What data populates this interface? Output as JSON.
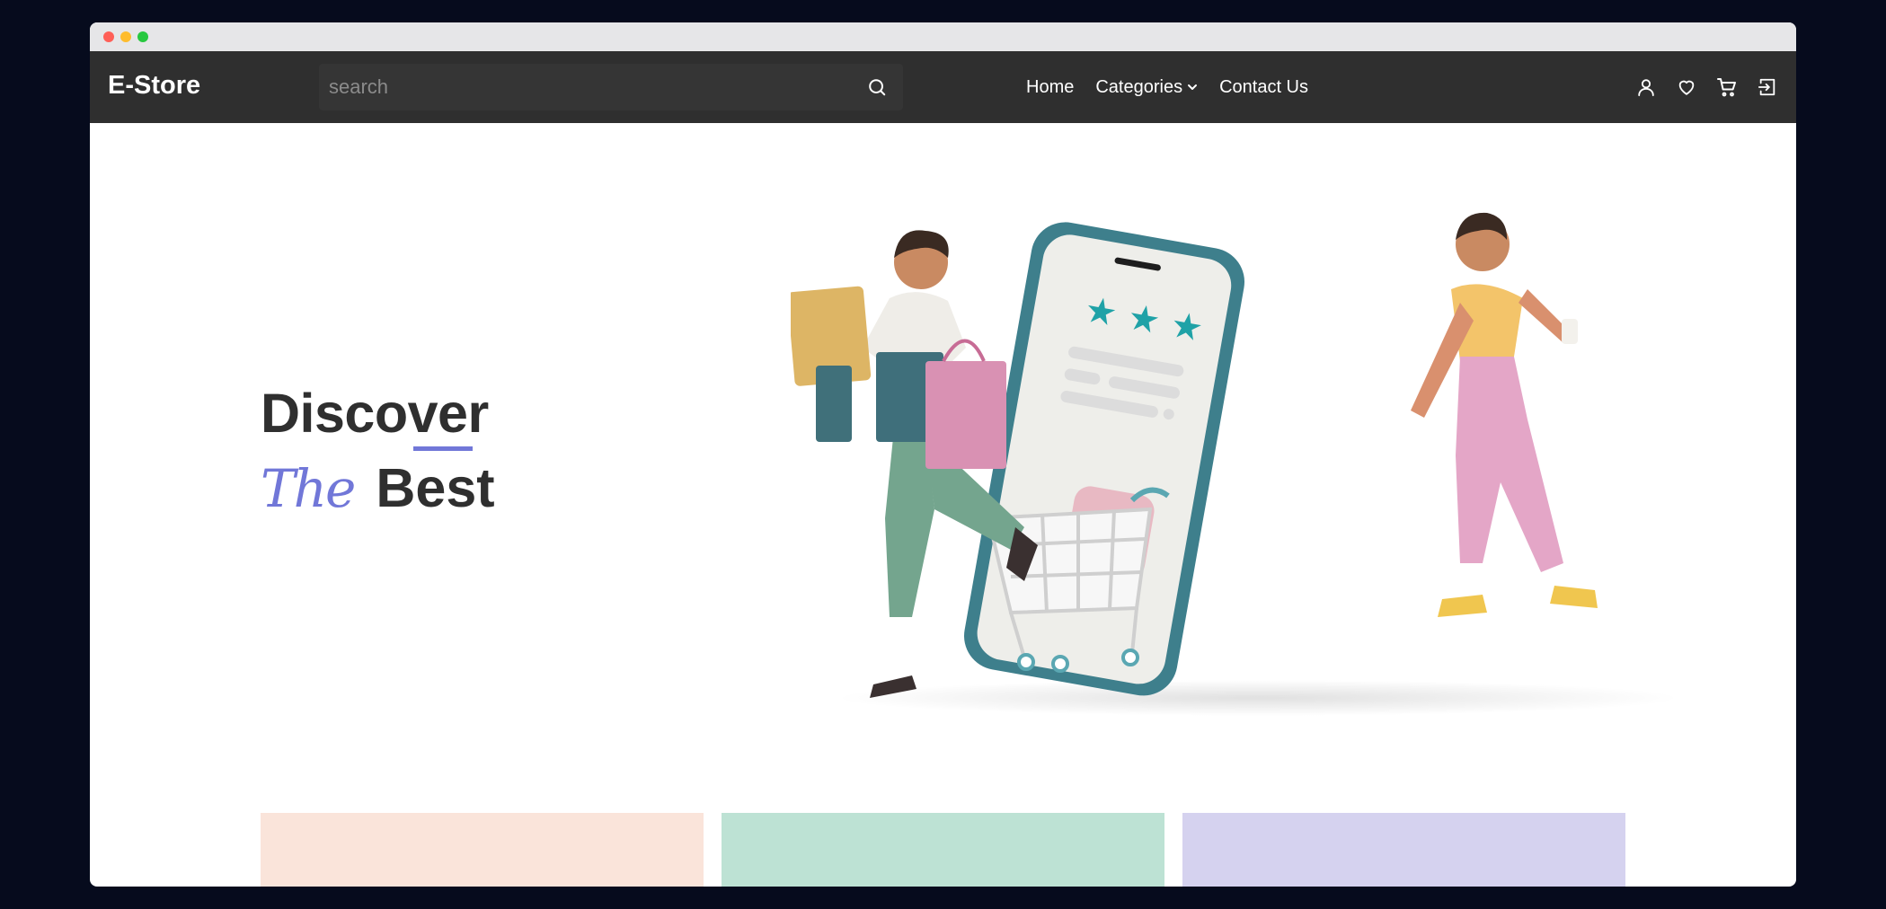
{
  "browser": {
    "traffic_lights": [
      "#ff5f57",
      "#febc2e",
      "#28c840"
    ]
  },
  "navbar": {
    "brand": "E-Store",
    "search": {
      "placeholder": "search",
      "value": "",
      "icon": "search-icon"
    },
    "links": [
      {
        "label": "Home"
      },
      {
        "label": "Categories",
        "icon": "chevron-down-icon"
      },
      {
        "label": "Contact Us"
      }
    ],
    "icons": [
      "user-icon",
      "heart-icon",
      "cart-icon",
      "login-icon"
    ]
  },
  "hero": {
    "line1": "Discover",
    "line2_script": "The",
    "line2": "Best",
    "accent_color": "#7177d8",
    "illustration": "shoppers-with-phone-and-cart-illustration"
  },
  "category_cards": [
    {
      "color": "#fae4da"
    },
    {
      "color": "#bde2d4"
    },
    {
      "color": "#d5d2ef"
    }
  ]
}
